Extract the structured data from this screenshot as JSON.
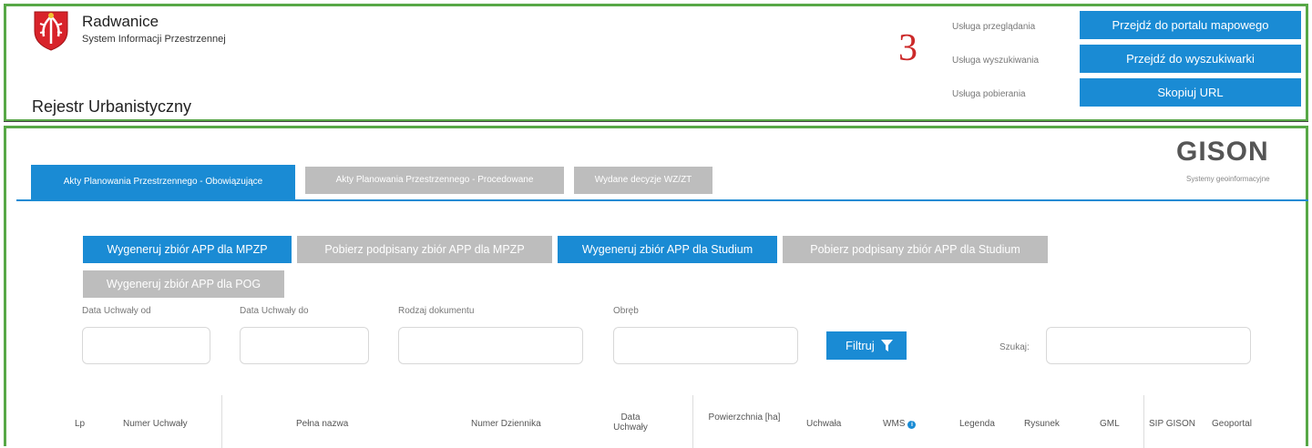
{
  "header": {
    "brand_name": "Radwanice",
    "brand_subtitle": "System Informacji Przestrzennej",
    "page_title": "Rejestr Urbanistyczny",
    "annotation_number": "3"
  },
  "services": [
    {
      "label": "Usługa przeglądania",
      "button": "Przejdź do portalu mapowego"
    },
    {
      "label": "Usługa wyszukiwania",
      "button": "Przejdź do wyszukiwarki"
    },
    {
      "label": "Usługa pobierania",
      "button": "Skopiuj URL"
    }
  ],
  "gison": {
    "logo_text": "GISON",
    "tagline": "Systemy geoinformacyjne"
  },
  "tabs": [
    {
      "label": "Akty Planowania Przestrzennego - Obowiązujące",
      "active": true
    },
    {
      "label": "Akty Planowania Przestrzennego - Procedowane",
      "active": false
    },
    {
      "label": "Wydane decyzje WZ/ZT",
      "active": false
    }
  ],
  "actions": [
    {
      "label": "Wygeneruj zbiór APP dla MPZP",
      "style": "primary"
    },
    {
      "label": "Pobierz podpisany zbiór APP dla MPZP",
      "style": "secondary"
    },
    {
      "label": "Wygeneruj zbiór APP dla Studium",
      "style": "primary"
    },
    {
      "label": "Pobierz podpisany zbiór APP dla Studium",
      "style": "secondary"
    },
    {
      "label": "Wygeneruj zbiór APP dla POG",
      "style": "secondary"
    }
  ],
  "filters": {
    "date_from_label": "Data Uchwały od",
    "date_from_value": "",
    "date_to_label": "Data Uchwały do",
    "date_to_value": "",
    "doc_type_label": "Rodzaj dokumentu",
    "doc_type_value": "",
    "precinct_label": "Obręb",
    "precinct_value": "",
    "filter_button": "Filtruj",
    "search_label": "Szukaj:",
    "search_value": ""
  },
  "table": {
    "columns": [
      "Lp",
      "Numer Uchwały",
      "Pełna nazwa",
      "Numer Dziennika",
      "Data Uchwały",
      "Powierzchnia [ha]",
      "Uchwała",
      "WMS",
      "Legenda",
      "Rysunek",
      "GML",
      "SIP GISON",
      "Geoportal"
    ]
  },
  "colors": {
    "primary": "#1a8bd4",
    "secondary": "#bdbdbd",
    "frame": "#57a846",
    "annotation": "#cc2a2a"
  },
  "icons": {
    "logo": "coat-of-arms-icon",
    "calendar": "calendar-icon",
    "dropdown": "chevron-down-icon",
    "filter": "funnel-icon",
    "search": "search-icon",
    "info": "info-icon"
  }
}
